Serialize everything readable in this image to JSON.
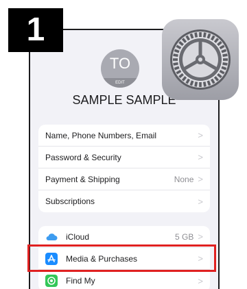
{
  "step": {
    "number": "1"
  },
  "profile": {
    "initials": "TO",
    "edit_label": "EDIT",
    "name": "SAMPLE SAMPLE"
  },
  "account_group": [
    {
      "label": "Name, Phone Numbers, Email",
      "value": ""
    },
    {
      "label": "Password & Security",
      "value": ""
    },
    {
      "label": "Payment & Shipping",
      "value": "None"
    },
    {
      "label": "Subscriptions",
      "value": ""
    }
  ],
  "services_group": [
    {
      "label": "iCloud",
      "value": "5 GB",
      "icon": "icloud-icon"
    },
    {
      "label": "Media & Purchases",
      "value": "",
      "icon": "app-store-icon"
    },
    {
      "label": "Find My",
      "value": "",
      "icon": "find-my-icon"
    }
  ],
  "chevron": ">",
  "colors": {
    "highlight": "#e02020",
    "app_store_blue": "#1a8cff",
    "find_my_green": "#34c759",
    "background": "#f2f2f7"
  },
  "overlay_icon": "settings-gear-icon"
}
